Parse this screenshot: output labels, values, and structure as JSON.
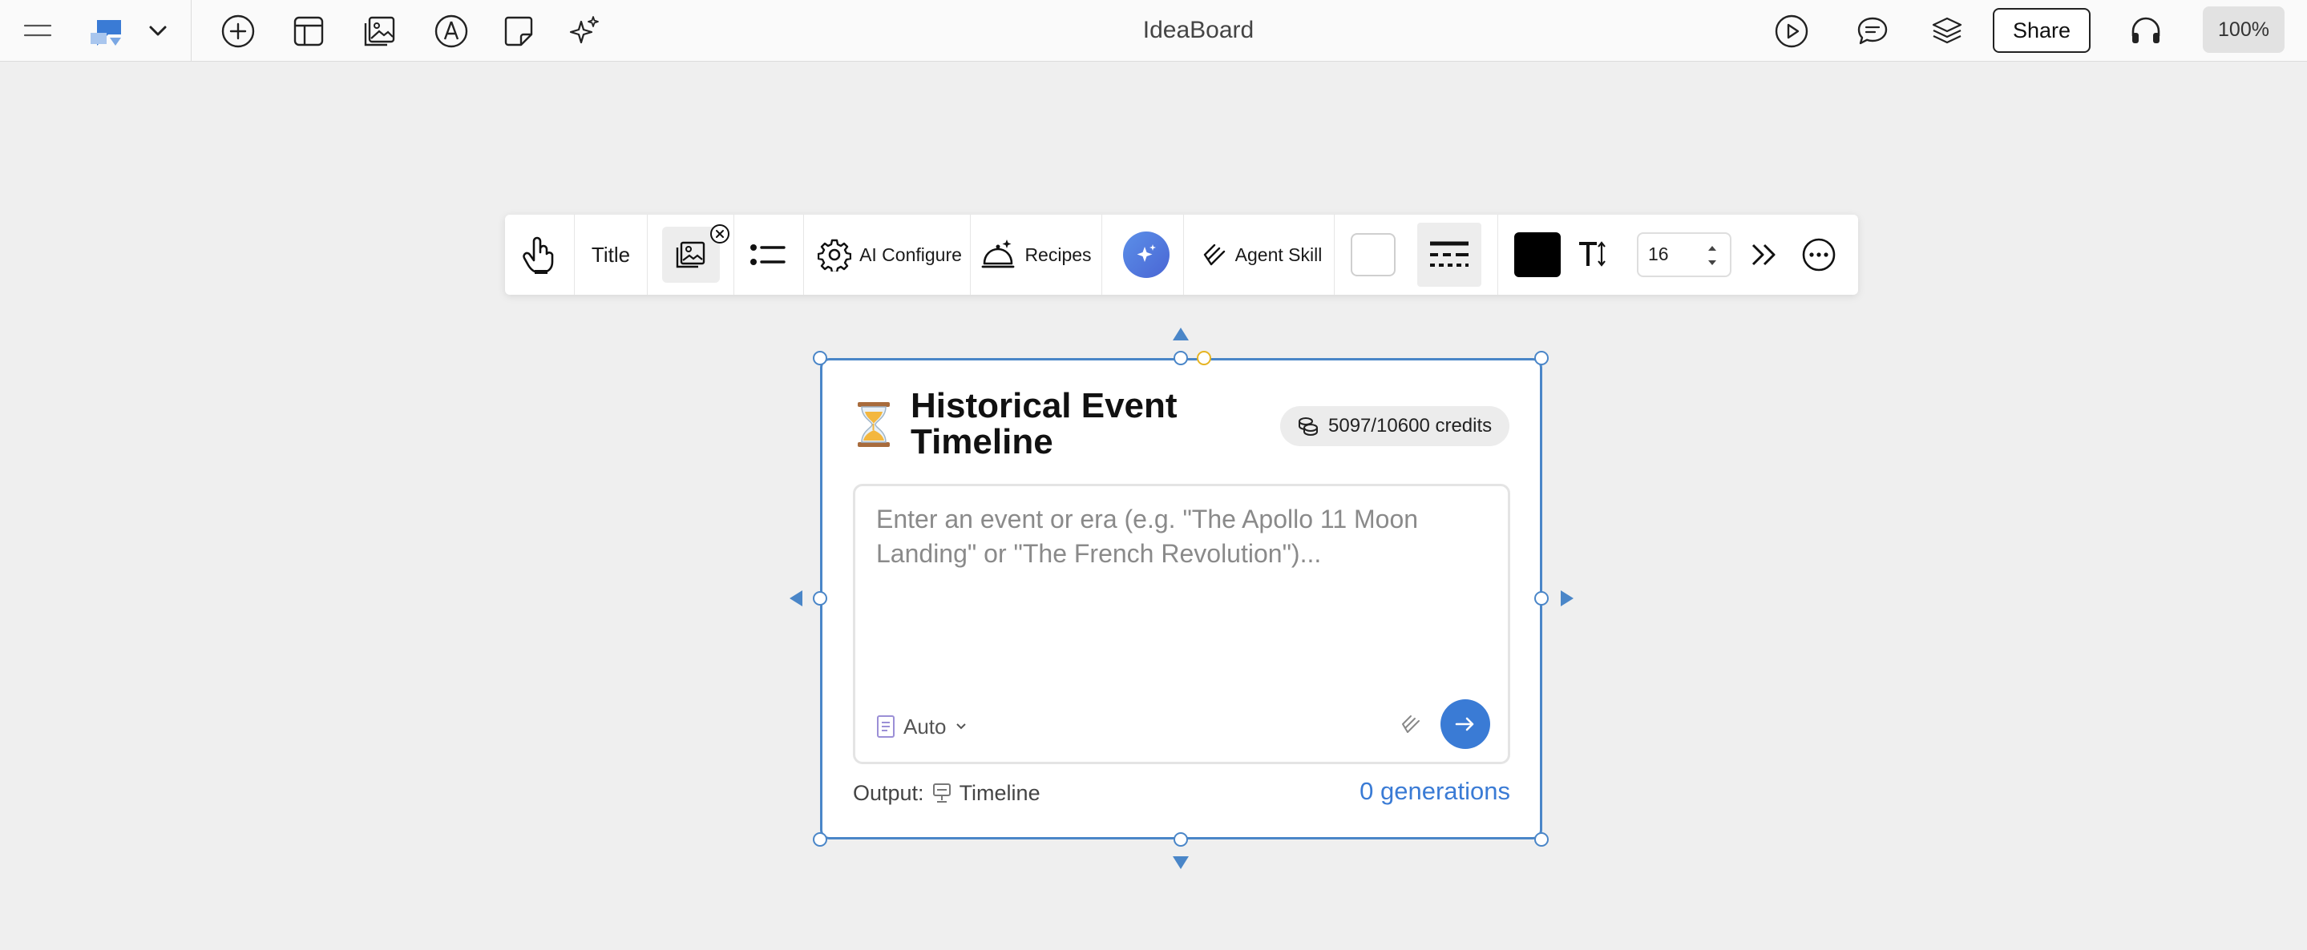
{
  "app": {
    "title": "IdeaBoard",
    "share_label": "Share",
    "zoom": "100%"
  },
  "topbar": {
    "left_icons": [
      "menu-icon",
      "board-logo-icon",
      "chevron-down-icon"
    ],
    "tool_icons": [
      "add-circle-icon",
      "layout-icon",
      "image-gallery-icon",
      "pen-circle-icon",
      "sticky-note-icon",
      "sparkles-icon"
    ],
    "right_icons": [
      "play-icon",
      "comment-icon",
      "layers-icon",
      "headphones-icon"
    ]
  },
  "toolbar": {
    "title_label": "Title",
    "ai_configure_label": "AI Configure",
    "recipes_label": "Recipes",
    "agent_skill_label": "Agent Skill",
    "font_size": "16",
    "fill_color": "#ffffff",
    "text_color": "#000000"
  },
  "card": {
    "emoji": "⏳",
    "title": "Historical Event Timeline",
    "credits": "5097/10600 credits",
    "prompt_placeholder": "Enter an event or era (e.g. \"The Apollo 11 Moon Landing\" or \"The French Revolution\")...",
    "prompt_value": "",
    "mode_label": "Auto",
    "output_label": "Output:",
    "output_type": "Timeline",
    "generations": "0 generations"
  },
  "colors": {
    "accent": "#3a7bd5",
    "selection": "#4a86c8",
    "canvas_bg": "#efefef"
  }
}
